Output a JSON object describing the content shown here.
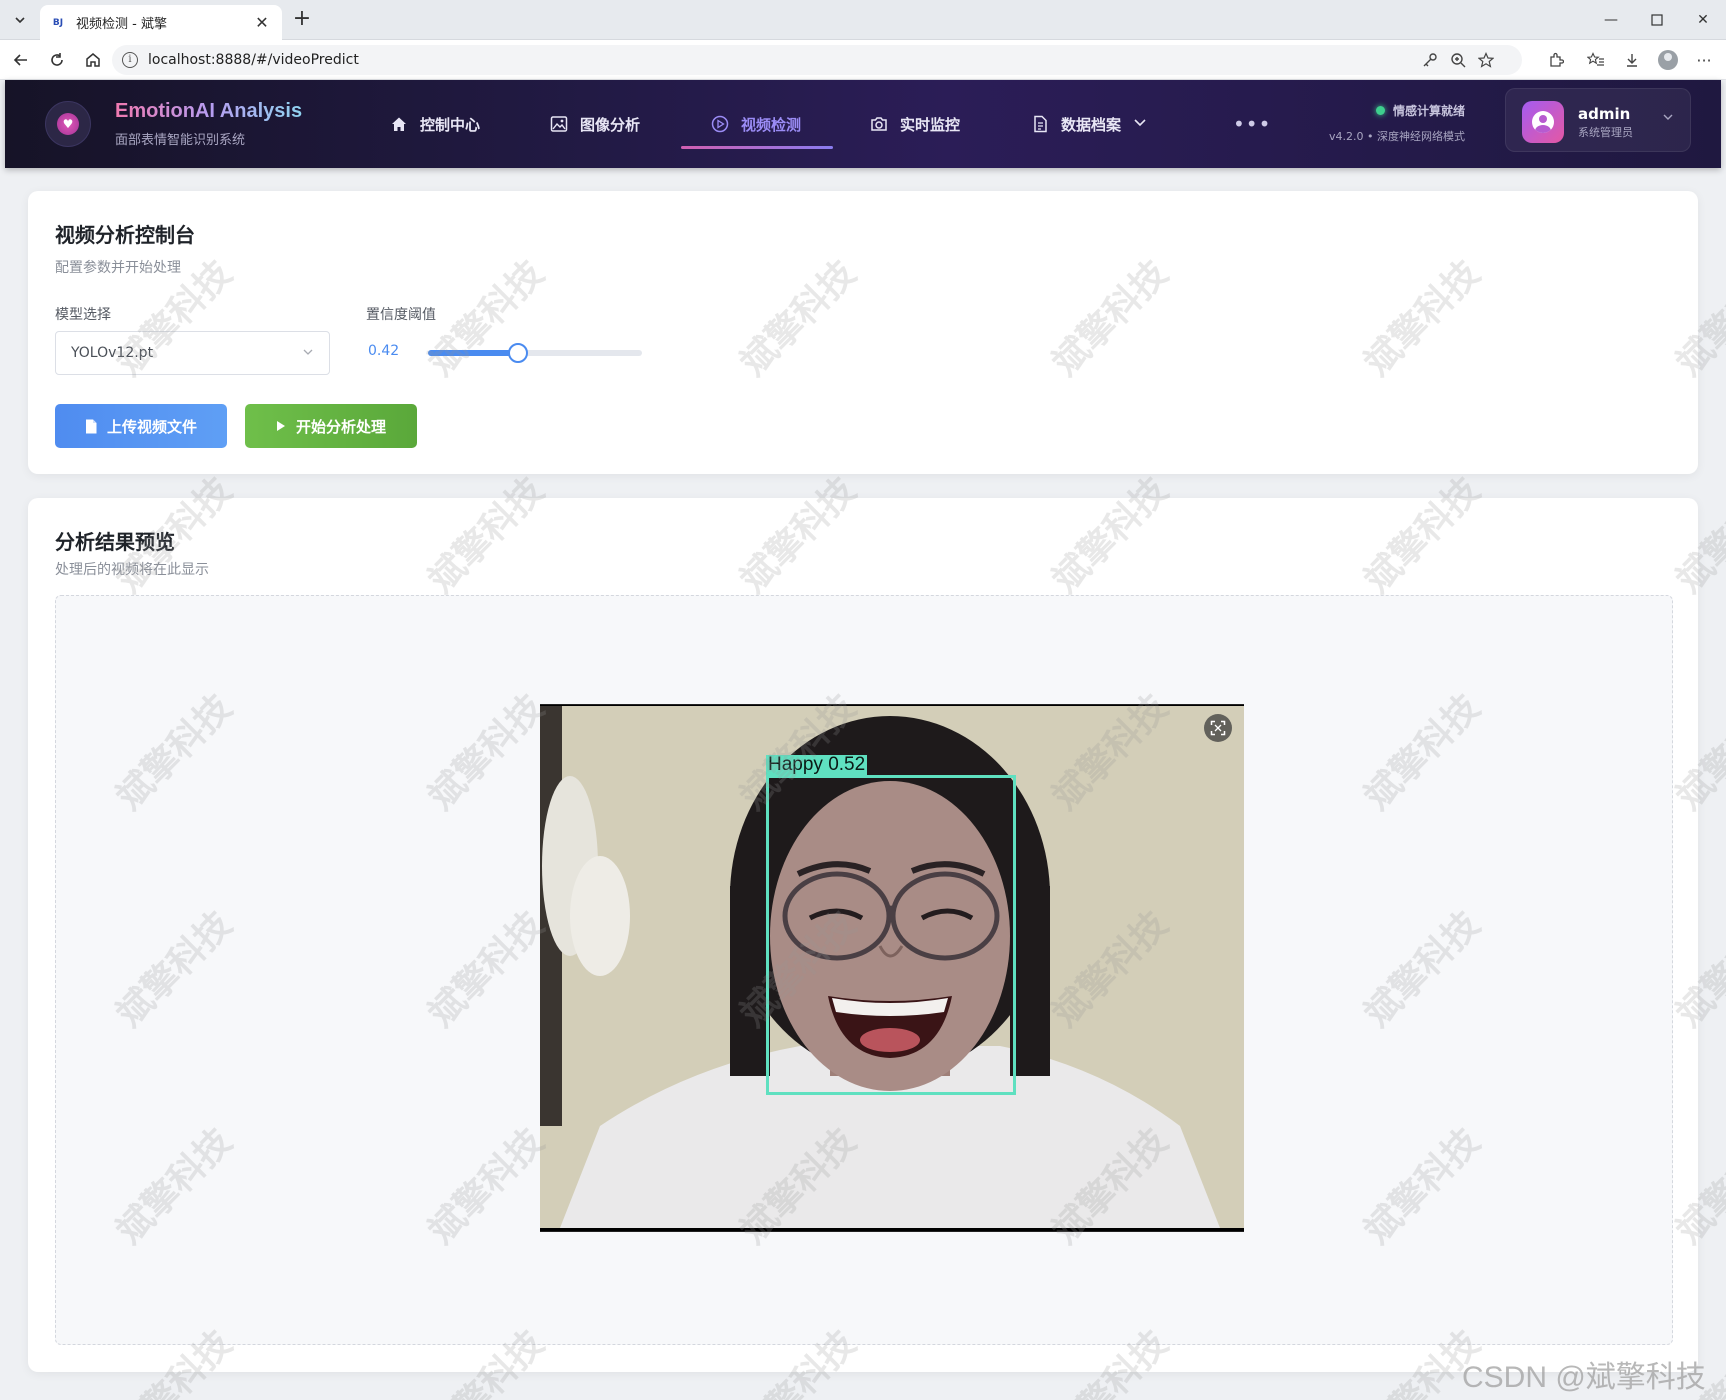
{
  "browser": {
    "tab_title": "视频检测 - 斌擎",
    "favicon_text": "BJ",
    "url": "localhost:8888/#/videoPredict"
  },
  "header": {
    "brand_title": "EmotionAI Analysis",
    "brand_subtitle": "面部表情智能识别系统",
    "nav": [
      {
        "label": "控制中心",
        "icon": "home-icon",
        "active": false
      },
      {
        "label": "图像分析",
        "icon": "image-icon",
        "active": false
      },
      {
        "label": "视频检测",
        "icon": "play-circle-icon",
        "active": true
      },
      {
        "label": "实时监控",
        "icon": "camera-icon",
        "active": false
      },
      {
        "label": "数据档案",
        "icon": "document-icon",
        "active": false
      }
    ],
    "more_label": "•••",
    "status_text": "情感计算就绪",
    "version_text": "v4.2.0 • 深度神经网络模式",
    "user_name": "admin",
    "user_role": "系统管理员",
    "accent_color": "#9b8cf5"
  },
  "control_panel": {
    "title": "视频分析控制台",
    "subtitle": "配置参数并开始处理",
    "model_label": "模型选择",
    "model_value": "YOLOv12.pt",
    "confidence_label": "置信度阈值",
    "confidence_value": "0.42",
    "confidence_fraction": 0.42,
    "upload_button": "上传视频文件",
    "start_button": "开始分析处理"
  },
  "results": {
    "title": "分析结果预览",
    "subtitle": "处理后的视频将在此显示",
    "detection_label": "Happy  0.52",
    "detection_color": "#5fe0c0"
  },
  "watermark": {
    "text": "斌擎科技",
    "credit": "CSDN @斌擎科技"
  }
}
